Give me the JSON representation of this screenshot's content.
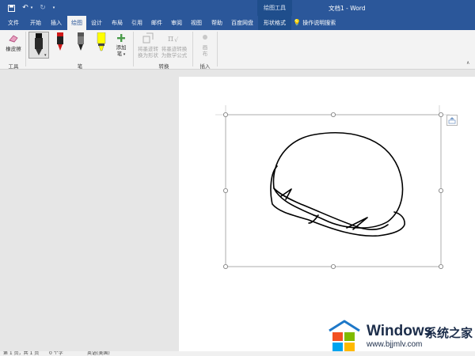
{
  "titlebar": {
    "context_group": "绘图工具",
    "document_title": "文档1  -  Word"
  },
  "tabs": [
    {
      "label": "文件"
    },
    {
      "label": "开始"
    },
    {
      "label": "插入"
    },
    {
      "label": "绘图"
    },
    {
      "label": "设计"
    },
    {
      "label": "布局"
    },
    {
      "label": "引用"
    },
    {
      "label": "邮件"
    },
    {
      "label": "审阅"
    },
    {
      "label": "视图"
    },
    {
      "label": "帮助"
    },
    {
      "label": "百度网盘"
    },
    {
      "label": "形状格式"
    }
  ],
  "active_tab": "绘图",
  "search": {
    "label": "操作说明搜索"
  },
  "ribbon": {
    "tools": {
      "eraser_label": "橡皮擦",
      "group_label": "工具"
    },
    "pens": {
      "add_pen_line1": "添加",
      "add_pen_line2": "笔",
      "group_label": "笔"
    },
    "convert": {
      "ink_to_shape_line1": "将墨迹转",
      "ink_to_shape_line2": "换为形状",
      "ink_to_math_line1": "将墨迹转换",
      "ink_to_math_line2": "为数学公式",
      "group_label": "转换"
    },
    "insert": {
      "canvas_line1": "画",
      "canvas_line2": "布",
      "group_label": "插入"
    }
  },
  "colors": {
    "accent": "#2b579a",
    "ribbon_bg": "#f3f3f3",
    "pen_red": "#d01919",
    "highlighter": "#ffff00"
  },
  "watermark": {
    "title": "Windows",
    "title_cn": "系统之家",
    "url": "www.bjjmlv.com"
  },
  "statusbar": {
    "page": "第 1 页，共 1 页",
    "words": "0 个字",
    "lang": "英语(美国)"
  }
}
